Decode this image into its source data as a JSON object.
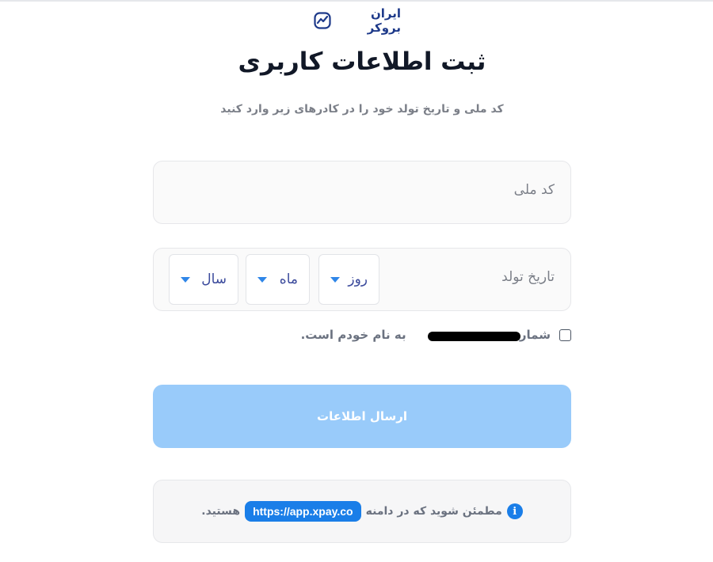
{
  "brand": {
    "logo_text": "ایران بروکر",
    "logo_icon": "trend-chart-icon",
    "color": "#1e3a8a"
  },
  "header": {
    "title": "ثبت اطلاعات کاربری",
    "subtitle": "کد ملی و تاریخ تولد خود را در کادرهای زیر وارد کنید"
  },
  "form": {
    "national_id": {
      "placeholder": "کد ملی",
      "value": ""
    },
    "birth_date": {
      "label": "تاریخ تولد",
      "day": "روز",
      "month": "ماه",
      "year": "سال"
    },
    "consent": {
      "text_before": "شماره",
      "text_after": "به نام خودم است.",
      "checked": false
    },
    "submit_label": "ارسال اطلاعات",
    "submit_color": "#99cbfa"
  },
  "notice": {
    "text_before": "مطمئن شوید که در دامنه",
    "domain": "https://app.xpay.co",
    "text_after": "هستید.",
    "icon": "info-icon",
    "accent": "#1a7ee8"
  }
}
